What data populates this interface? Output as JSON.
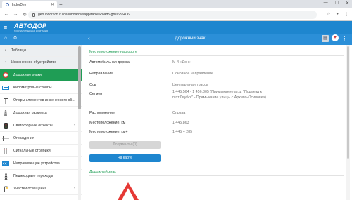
{
  "browser": {
    "tab_title": "IndorDev",
    "url": "geo.indorsoft.ru/dashboard/#/app/table/RoadSigns/685406"
  },
  "app": {
    "logo_text": "АВТОДОР",
    "logo_subtitle": "ГОСУДАРСТВЕННАЯ КОМПАНИЯ"
  },
  "toolbar": {
    "title": "Дорожный знак"
  },
  "sidebar": {
    "items": [
      {
        "label": "Таблицы"
      },
      {
        "label": "Инженерное обустройство"
      },
      {
        "label": "Дорожные знаки"
      },
      {
        "label": "Километровые столбы"
      },
      {
        "label": "Опоры элементов инженерного об..."
      },
      {
        "label": "Дорожная разметка"
      },
      {
        "label": "Светофорные объекты"
      },
      {
        "label": "Ограждения"
      },
      {
        "label": "Сигнальные столбики"
      },
      {
        "label": "Направляющие устройства"
      },
      {
        "label": "Пешеходные переходы"
      },
      {
        "label": "Участки освещения"
      }
    ]
  },
  "main": {
    "section_location": "Местоположение на дороге",
    "fields": [
      {
        "label": "Автомобильная дорога",
        "value": "М-4 «Дон»"
      },
      {
        "label": "Направление",
        "value": "Основное направление"
      },
      {
        "label": "Ось",
        "value": "Центральная трасса"
      },
      {
        "label": "Сегмент",
        "value": "1 445,564 - 1 456,305 (Примыкание ат.д. \"Подъезд к п.г.т.Двубск\" - Примыкание улицы с.Архипо-Осиповка)"
      },
      {
        "label": "Расположение",
        "value": "Справа"
      },
      {
        "label": "Местоположение, км",
        "value": "1 445,863"
      },
      {
        "label": "Местоположение, км+",
        "value": "1 445 + 285"
      }
    ],
    "documents_button": "Документы (0)",
    "map_button": "На карте",
    "section_sign": "Дорожный знак"
  }
}
